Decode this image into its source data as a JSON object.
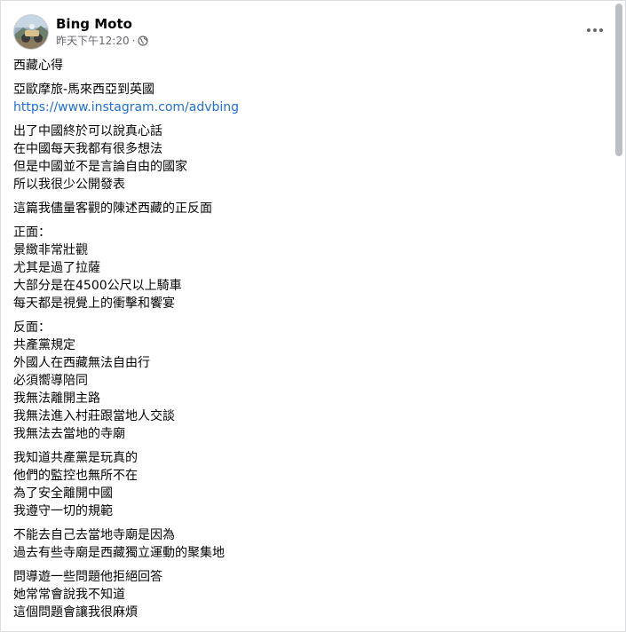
{
  "post": {
    "author": "Bing Moto",
    "timestamp": "昨天下午12:20",
    "separator": "·",
    "privacy_icon": "globe-icon",
    "more_icon": "more-options-icon"
  },
  "content": {
    "title": "西藏心得",
    "intro": {
      "line1": "亞歐摩旅-馬來西亞到英國",
      "link": "https://www.instagram.com/advbing"
    },
    "p1": [
      "出了中國終於可以說真心話",
      "在中國每天我都有很多想法",
      "但是中國並不是言論自由的國家",
      "所以我很少公開發表"
    ],
    "p2": [
      "這篇我儘量客觀的陳述西藏的正反面"
    ],
    "p3": [
      "正面：",
      "景緻非常壯觀",
      "尤其是過了拉薩",
      "大部分是在4500公尺以上騎車",
      "每天都是視覺上的衝擊和饗宴"
    ],
    "p4": [
      "反面：",
      "共產黨規定",
      "外國人在西藏無法自由行",
      "必須嚮導陪同",
      "我無法離開主路",
      "我無法進入村莊跟當地人交談",
      "我無法去當地的寺廟"
    ],
    "p5": [
      "我知道共產黨是玩真的",
      "他們的監控也無所不在",
      "為了安全離開中國",
      "我遵守一切的規範"
    ],
    "p6": [
      "不能去自己去當地寺廟是因為",
      "過去有些寺廟是西藏獨立運動的聚集地"
    ],
    "p7": [
      "問導遊一些問題他拒絕回答",
      "她常常會說我不知道",
      "這個問題會讓我很麻煩"
    ]
  },
  "colors": {
    "text": "#050505",
    "secondary": "#65676b",
    "link": "#216fdb",
    "scroll_thumb": "#bcc0c4"
  }
}
